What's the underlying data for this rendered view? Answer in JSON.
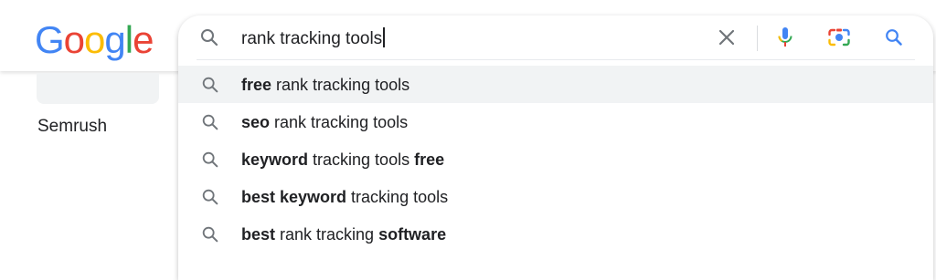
{
  "logo": {
    "letters": [
      "G",
      "o",
      "o",
      "g",
      "l",
      "e"
    ],
    "colors": [
      "#4285F4",
      "#EA4335",
      "#FBBC05",
      "#4285F4",
      "#34A853",
      "#EA4335"
    ]
  },
  "search": {
    "query": "rank tracking tools"
  },
  "icons": {
    "search": "magnifier-icon",
    "clear": "close-icon",
    "voice": "microphone-icon",
    "lens": "camera-icon",
    "submit": "search-icon"
  },
  "colors": {
    "icon_gray": "#70757a",
    "google_blue": "#4285F4"
  },
  "background": {
    "result_label": "Semrush"
  },
  "suggestions": [
    {
      "parts": [
        {
          "t": "free",
          "b": true
        },
        {
          "t": " rank tracking tools",
          "b": false
        }
      ]
    },
    {
      "parts": [
        {
          "t": "seo",
          "b": true
        },
        {
          "t": " rank tracking tools",
          "b": false
        }
      ]
    },
    {
      "parts": [
        {
          "t": "keyword",
          "b": true
        },
        {
          "t": " tracking tools ",
          "b": false
        },
        {
          "t": "free",
          "b": true
        }
      ]
    },
    {
      "parts": [
        {
          "t": "best keyword",
          "b": true
        },
        {
          "t": " tracking tools",
          "b": false
        }
      ]
    },
    {
      "parts": [
        {
          "t": "best",
          "b": true
        },
        {
          "t": " rank tracking ",
          "b": false
        },
        {
          "t": "software",
          "b": true
        }
      ]
    }
  ]
}
